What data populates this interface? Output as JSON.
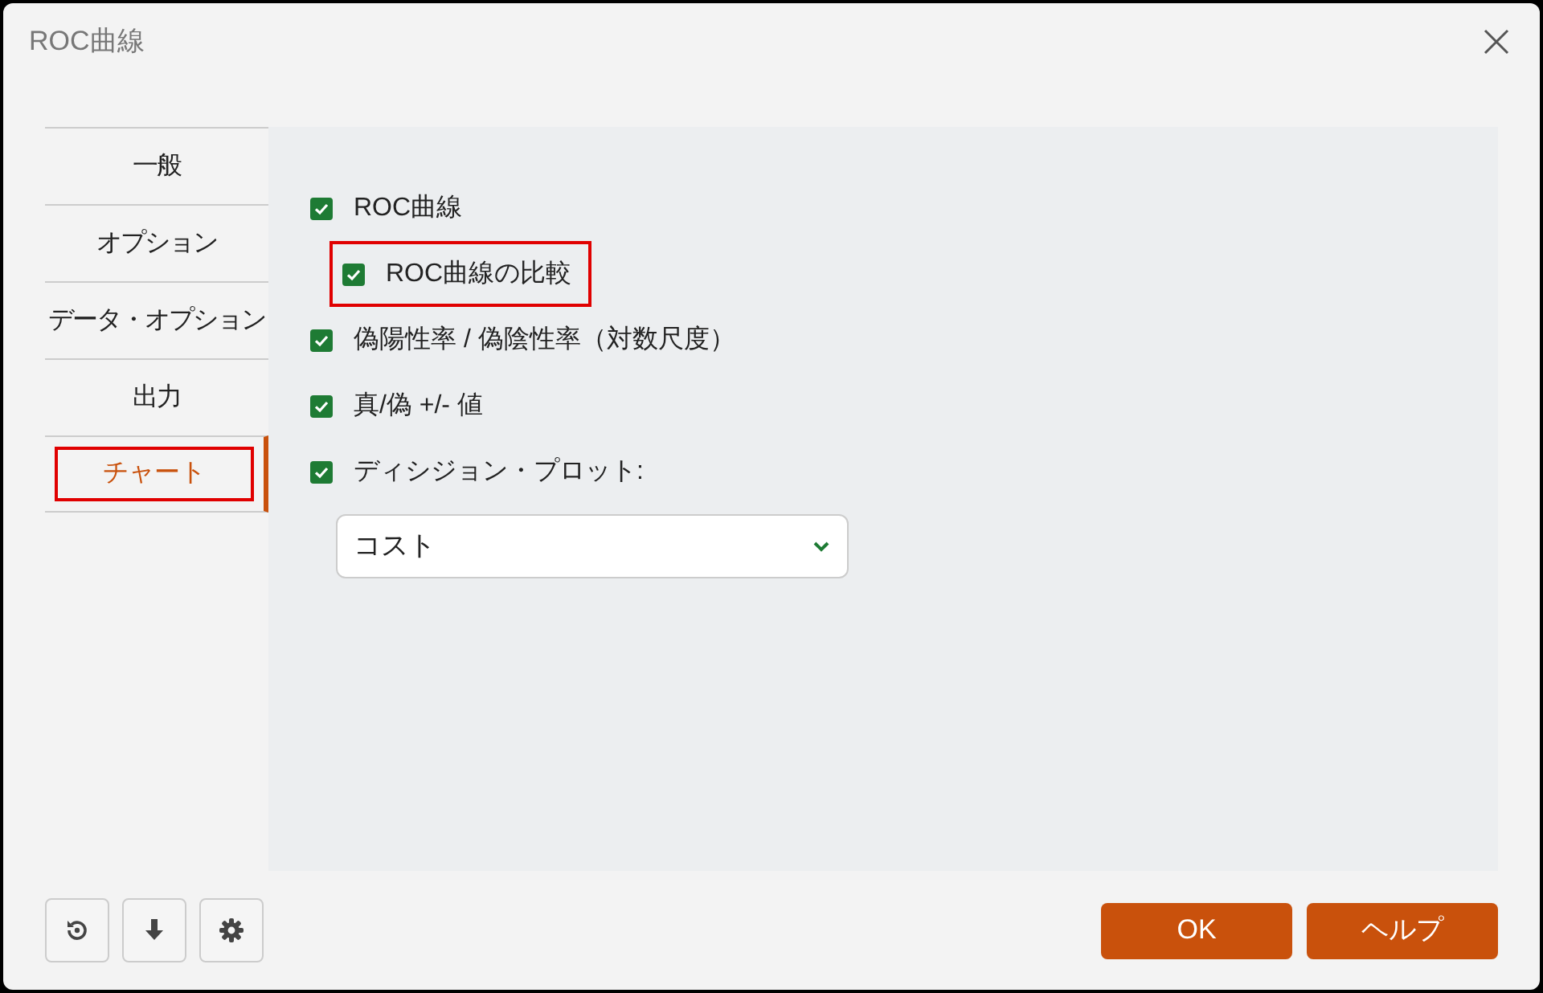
{
  "window": {
    "title": "ROC曲線"
  },
  "tabs": [
    {
      "label": "一般",
      "selected": false,
      "highlighted": false
    },
    {
      "label": "オプション",
      "selected": false,
      "highlighted": false
    },
    {
      "label": "データ・オプション",
      "selected": false,
      "highlighted": false
    },
    {
      "label": "出力",
      "selected": false,
      "highlighted": false
    },
    {
      "label": "チャート",
      "selected": true,
      "highlighted": true
    }
  ],
  "options": [
    {
      "label": "ROC曲線",
      "checked": true,
      "highlighted": false,
      "children": [
        {
          "label": "ROC曲線の比較",
          "checked": true,
          "highlighted": true
        }
      ]
    },
    {
      "label": "偽陽性率 / 偽陰性率（対数尺度）",
      "checked": true,
      "highlighted": false
    },
    {
      "label": "真/偽 +/- 値",
      "checked": true,
      "highlighted": false
    },
    {
      "label": "ディシジョン・プロット:",
      "checked": true,
      "highlighted": false
    }
  ],
  "decision_plot_select": {
    "value": "コスト"
  },
  "buttons": [
    {
      "label": "OK"
    },
    {
      "label": "ヘルプ"
    }
  ]
}
